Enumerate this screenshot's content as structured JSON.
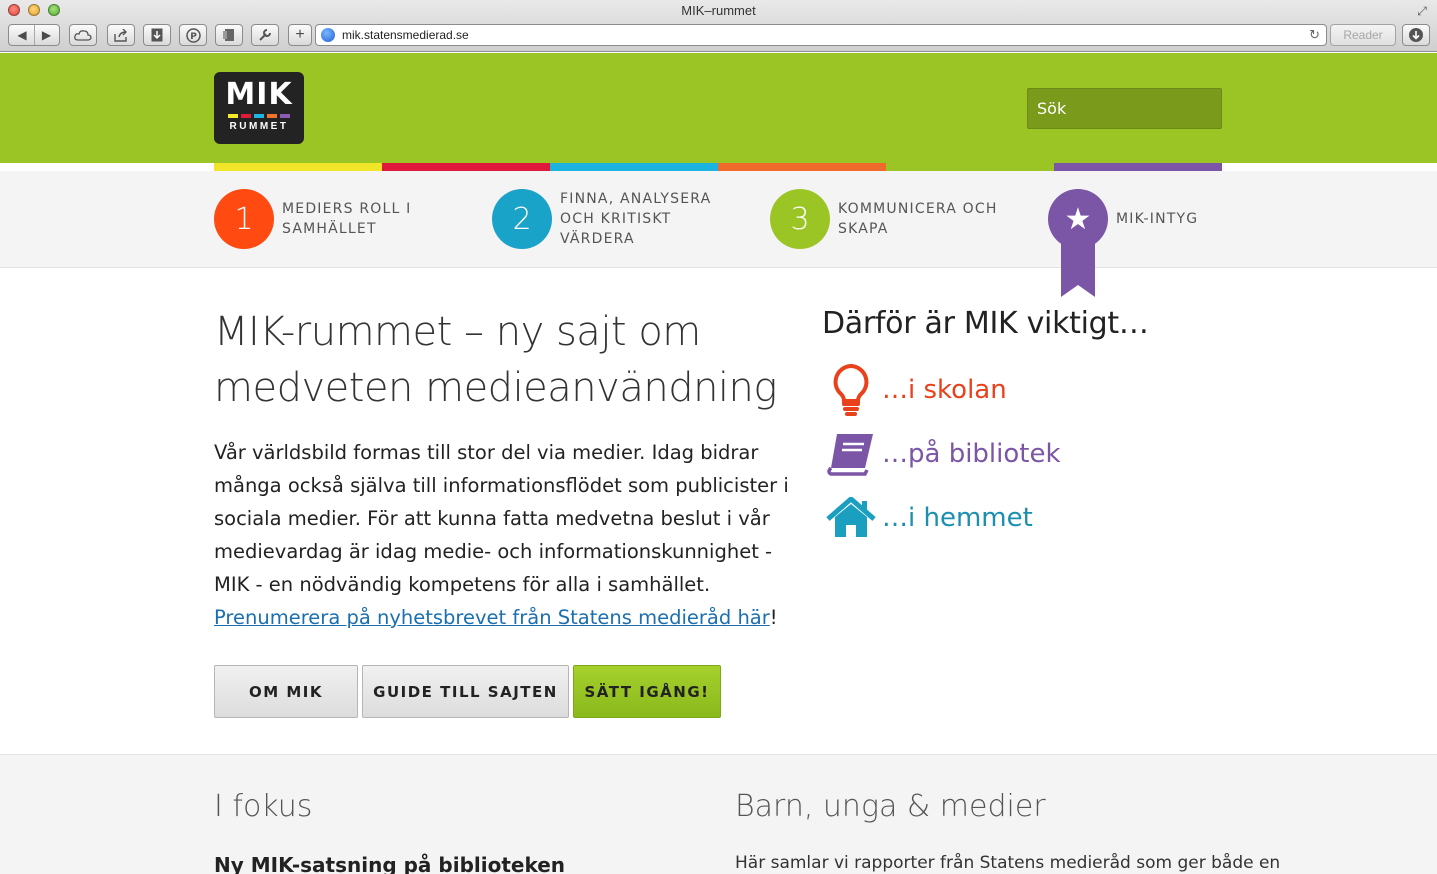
{
  "browser": {
    "window_title": "MIK–rummet",
    "url": "mik.statensmedierad.se",
    "reader_label": "Reader"
  },
  "header": {
    "logo_top": "MIK",
    "logo_bottom": "RUMMET",
    "search_placeholder": "Sök",
    "strip_colors": [
      "#f1e52a",
      "#e0183c",
      "#1db3e0",
      "#f06a2c",
      "#9bc524",
      "#7b55a6"
    ],
    "logo_bar_colors": [
      "#f7e72b",
      "#e11a3c",
      "#1eb4e4",
      "#f0742c",
      "#8b5cb2"
    ]
  },
  "themes": [
    {
      "number": "1",
      "label": "MEDIERS ROLL I SAMHÄLLET",
      "color": "#ff4a12"
    },
    {
      "number": "2",
      "label": "FINNA, ANALYSERA OCH KRITISKT VÄRDERA",
      "color": "#1aa3c8"
    },
    {
      "number": "3",
      "label": "KOMMUNICERA OCH SKAPA",
      "color": "#9bc524"
    }
  ],
  "intyg": {
    "label": "MIK-INTYG",
    "color": "#7b55a6",
    "icon": "star-icon"
  },
  "main": {
    "headline": "MIK-rummet – ny sajt om medveten medieanvändning",
    "lead": "Vår världsbild formas till stor del via medier. Idag bidrar många också själva till informationsflödet som publicister i sociala medier. För att kunna fatta medvetna beslut i vår medievardag är idag medie- och informationskunnighet - MIK - en nödvändig kompetens för alla i samhället.",
    "subscribe_link": "Prenumerera på nyhetsbrevet från Statens medieråd här",
    "subscribe_suffix": "!",
    "buttons": {
      "om_mik": "OM MIK",
      "guide": "GUIDE TILL SAJTEN",
      "start": "SÄTT IGÅNG!"
    }
  },
  "why": {
    "title": "Därför är MIK viktigt…",
    "items": [
      {
        "label": "…i skolan",
        "color": "#e8411b",
        "icon": "lightbulb-icon"
      },
      {
        "label": "…på bibliotek",
        "color": "#7b55a6",
        "icon": "book-icon"
      },
      {
        "label": "…i hemmet",
        "color": "#1a8fb0",
        "icon": "house-icon"
      }
    ]
  },
  "bottom": {
    "focus_title": "I fokus",
    "focus_article": "Ny MIK-satsning på biblioteken",
    "youth_title": "Barn, unga & medier",
    "youth_text": "Här samlar vi rapporter från Statens medieråd som ger både en"
  }
}
